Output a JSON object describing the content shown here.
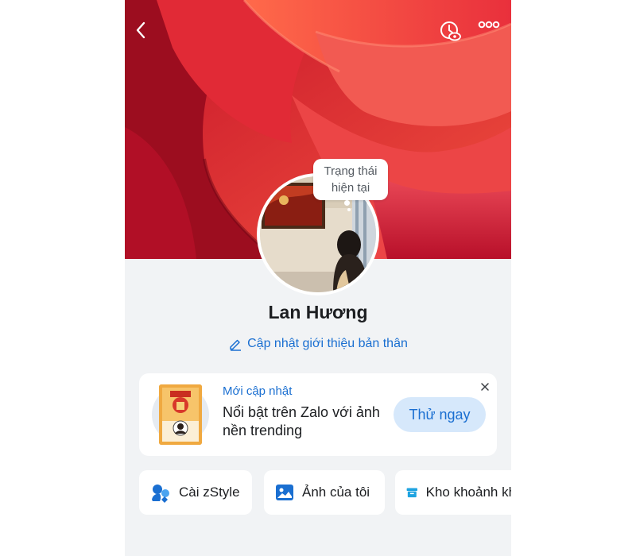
{
  "header": {
    "back_icon": "chevron-left-icon",
    "history_icon": "clock-eye-icon",
    "more_icon": "more-dots-icon"
  },
  "status_bubble": {
    "line1": "Trạng thái",
    "line2": "hiện tại"
  },
  "profile": {
    "name": "Lan Hương",
    "update_intro": "Cập nhật giới thiệu bản thân",
    "update_intro_icon": "pencil-icon"
  },
  "promo": {
    "label": "Mới cập nhật",
    "text": "Nổi bật trên Zalo với ảnh nền trending",
    "button": "Thử ngay",
    "close_icon": "close-icon"
  },
  "chips": [
    {
      "label": "Cài zStyle",
      "icon": "zstyle-icon"
    },
    {
      "label": "Ảnh của tôi",
      "icon": "photo-icon"
    },
    {
      "label": "Kho khoảnh khắc",
      "icon": "archive-box-icon"
    }
  ],
  "colors": {
    "accent": "#1a6fd1",
    "button_bg": "#d6e8fb",
    "page_bg": "#f1f3f5",
    "cover_red": "#e8333a"
  }
}
